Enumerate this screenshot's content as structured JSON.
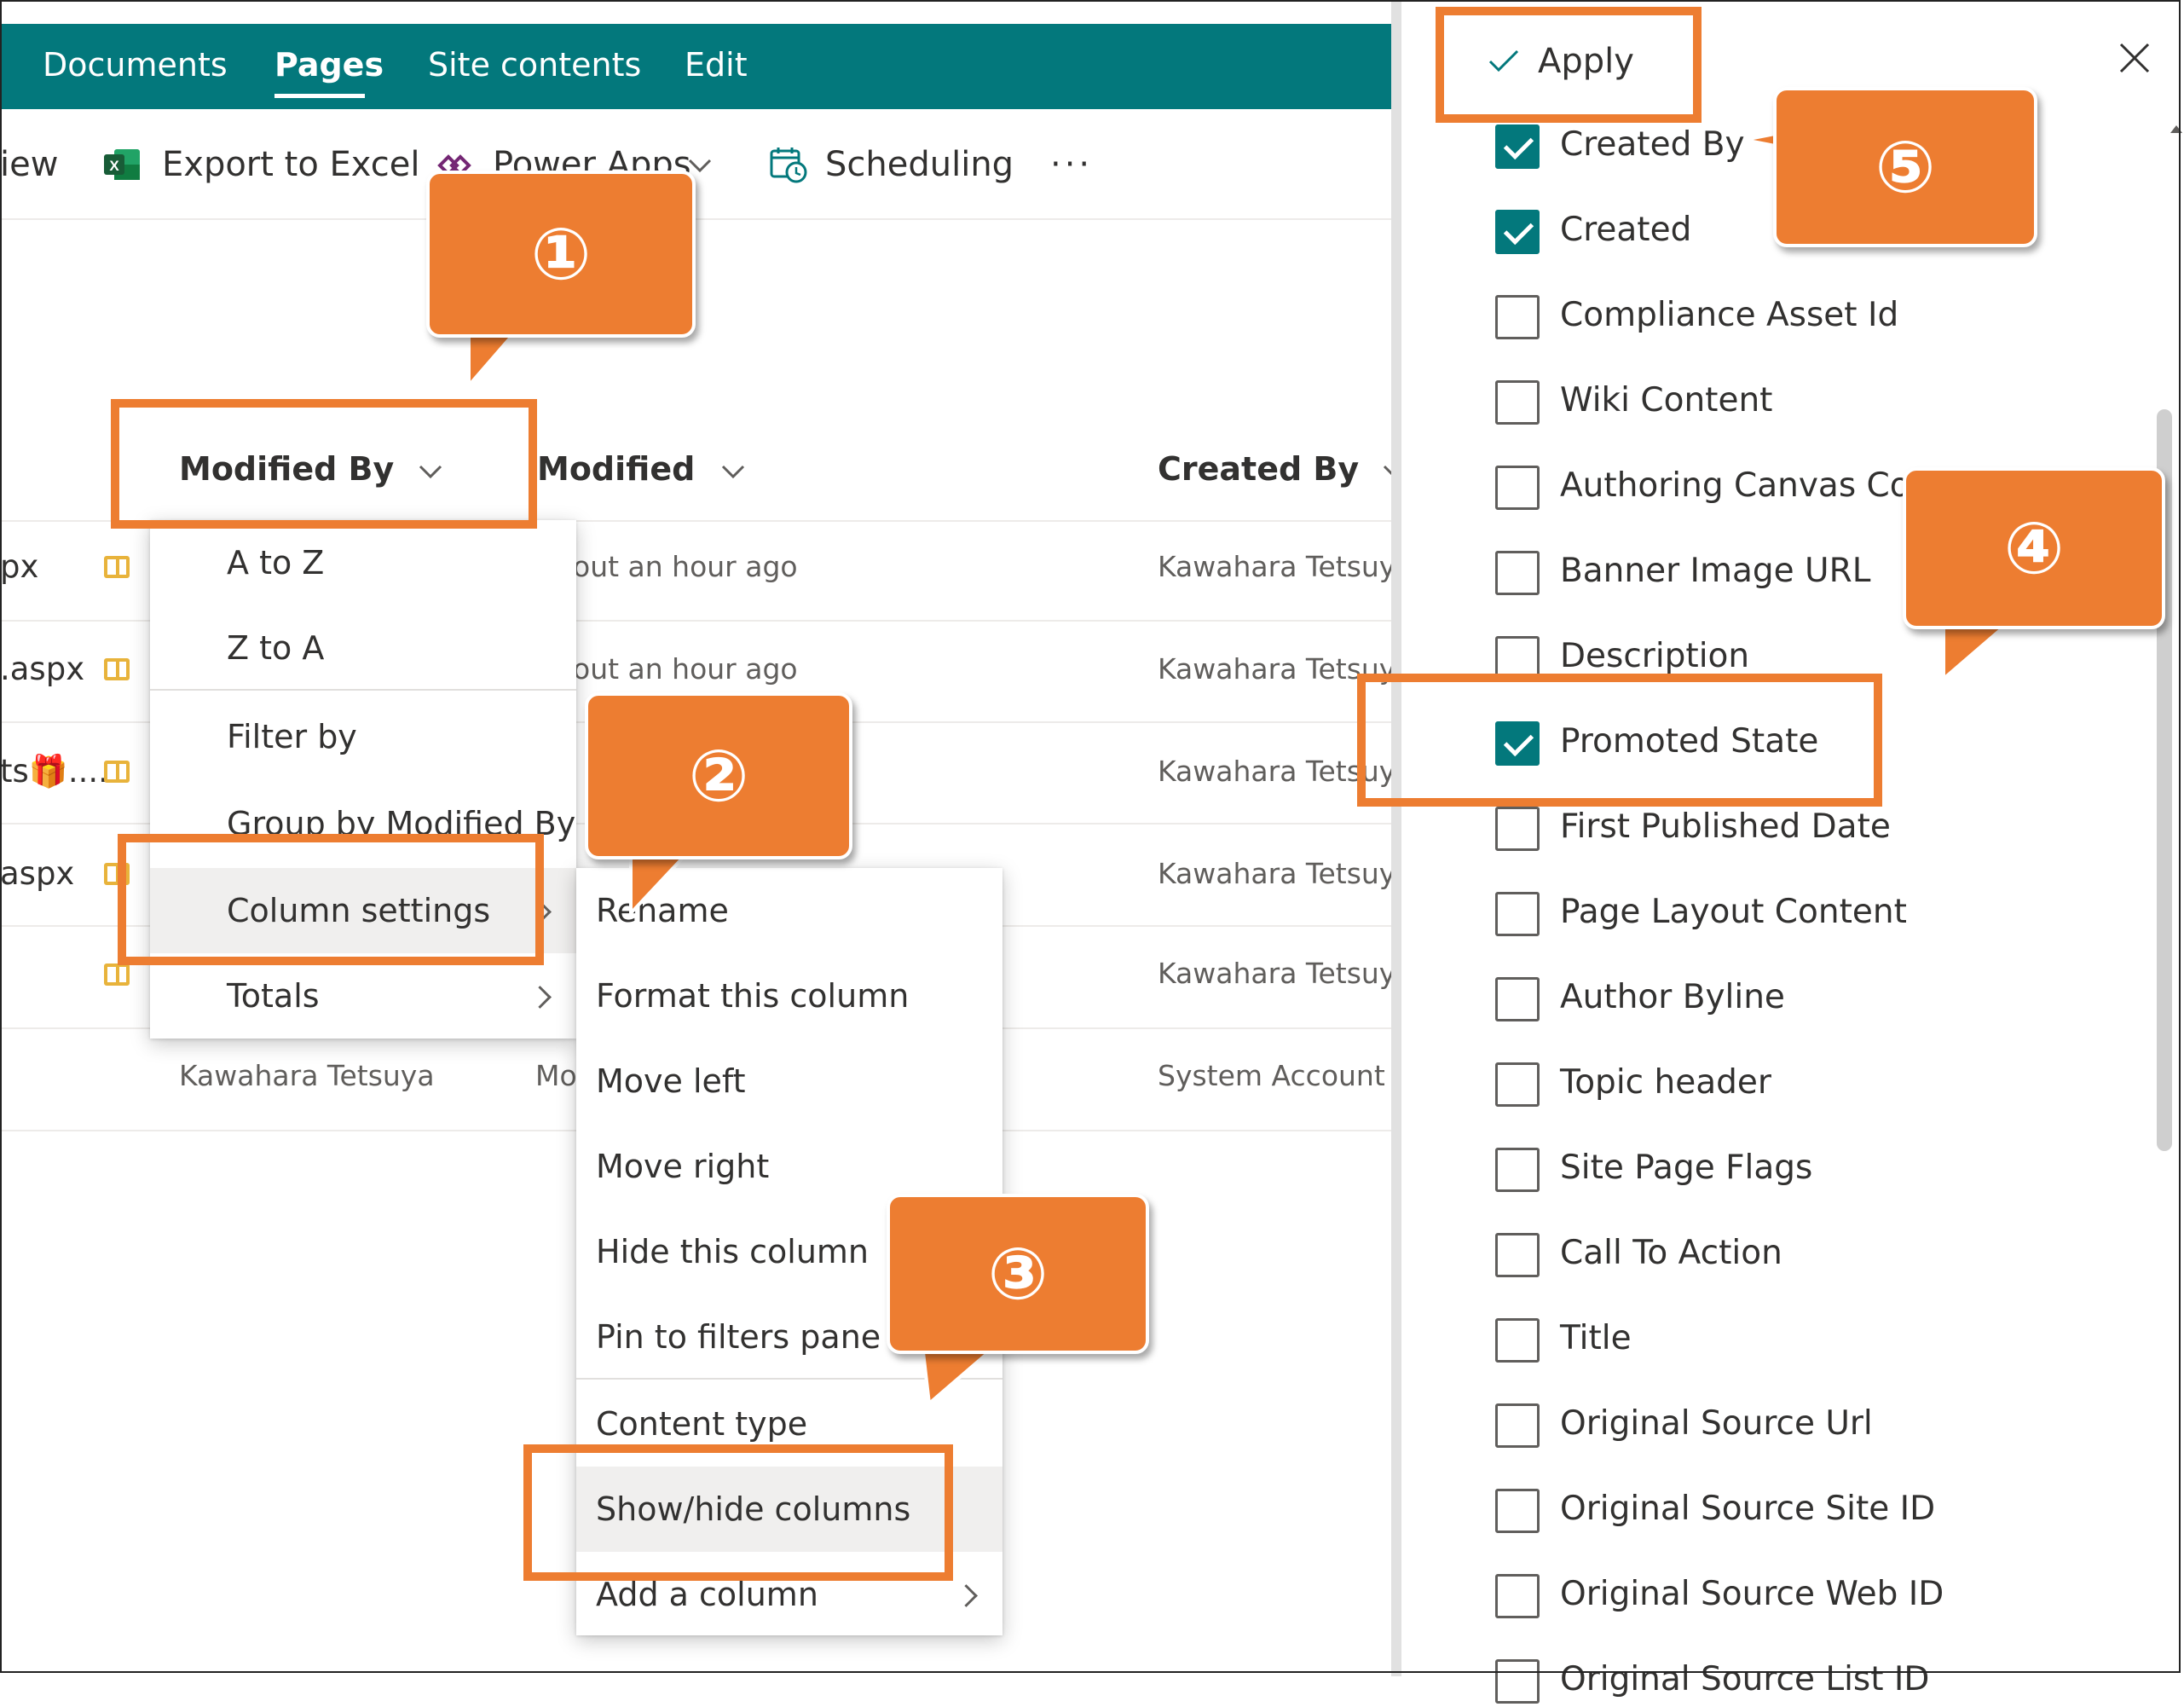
{
  "nav": {
    "items": [
      "Documents",
      "Pages",
      "Site contents",
      "Edit"
    ],
    "active": "Pages"
  },
  "commandbar": {
    "view_fragment": "iew",
    "export": "Export to Excel",
    "powerapps": "Power Apps",
    "scheduling": "Scheduling",
    "more": "···"
  },
  "list": {
    "headers": {
      "modified_by": "Modified By",
      "modified": "Modified",
      "created_by": "Created By"
    },
    "rows": [
      {
        "name": "px",
        "modified": "out an hour ago",
        "created_by": "Kawahara Tetsuya"
      },
      {
        "name": ".aspx",
        "modified": "out an hour ago",
        "created_by": "Kawahara Tetsuya"
      },
      {
        "name": "ts🎁....",
        "created_by": "Kawahara Tetsuya"
      },
      {
        "name": "aspx",
        "created_by": "Kawahara Tetsuya"
      },
      {
        "name": "",
        "created_by": "Kawahara Tetsuya"
      },
      {
        "modified_by": "Kawahara Tetsuya",
        "modified": "Mo",
        "created_by": "System Account"
      }
    ]
  },
  "column_menu": {
    "items": [
      "A to Z",
      "Z to A",
      "Filter by",
      "Group by Modified By",
      "Column settings",
      "Totals"
    ]
  },
  "submenu": {
    "items": [
      "Rename",
      "Format this column",
      "Move left",
      "Move right",
      "Hide this column",
      "Pin to filters pane",
      "Content type",
      "Show/hide columns",
      "Add a column"
    ]
  },
  "panel": {
    "apply": "Apply",
    "columns": [
      {
        "label": "Created By",
        "checked": true
      },
      {
        "label": "Created",
        "checked": true
      },
      {
        "label": "Compliance Asset Id",
        "checked": false
      },
      {
        "label": "Wiki Content",
        "checked": false
      },
      {
        "label": "Authoring Canvas Conte",
        "checked": false
      },
      {
        "label": "Banner Image URL",
        "checked": false
      },
      {
        "label": "Description",
        "checked": false
      },
      {
        "label": "Promoted State",
        "checked": true
      },
      {
        "label": "First Published Date",
        "checked": false
      },
      {
        "label": "Page Layout Content",
        "checked": false
      },
      {
        "label": "Author Byline",
        "checked": false
      },
      {
        "label": "Topic header",
        "checked": false
      },
      {
        "label": "Site Page Flags",
        "checked": false
      },
      {
        "label": "Call To Action",
        "checked": false
      },
      {
        "label": "Title",
        "checked": false
      },
      {
        "label": "Original Source Url",
        "checked": false
      },
      {
        "label": "Original Source Site ID",
        "checked": false
      },
      {
        "label": "Original Source Web ID",
        "checked": false
      },
      {
        "label": "Original Source List ID",
        "checked": false
      }
    ]
  },
  "callouts": [
    "①",
    "②",
    "③",
    "④",
    "⑤"
  ],
  "colors": {
    "nav": "#03787c",
    "checkbox": "#03787c",
    "annotation": "#ed7d31"
  }
}
